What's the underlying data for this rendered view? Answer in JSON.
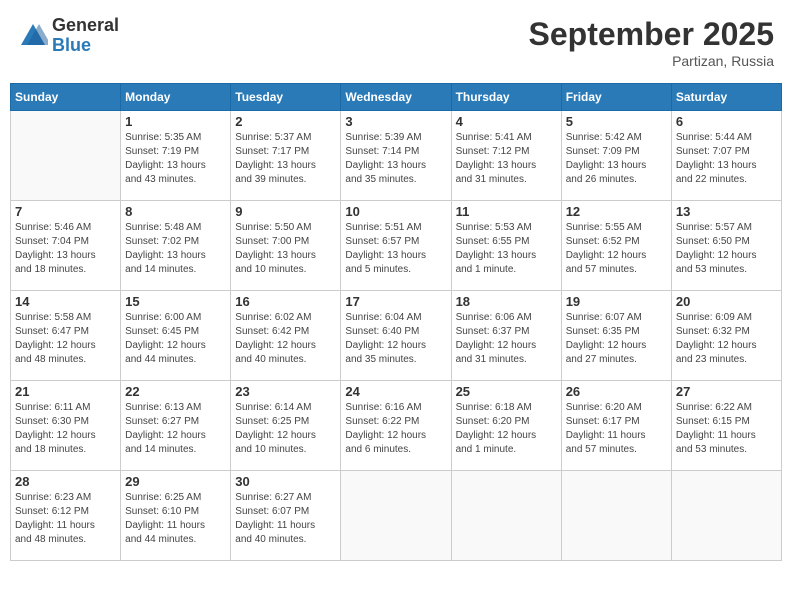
{
  "header": {
    "logo_general": "General",
    "logo_blue": "Blue",
    "month_title": "September 2025",
    "subtitle": "Partizan, Russia"
  },
  "days_of_week": [
    "Sunday",
    "Monday",
    "Tuesday",
    "Wednesday",
    "Thursday",
    "Friday",
    "Saturday"
  ],
  "weeks": [
    [
      {
        "day": "",
        "info": ""
      },
      {
        "day": "1",
        "info": "Sunrise: 5:35 AM\nSunset: 7:19 PM\nDaylight: 13 hours\nand 43 minutes."
      },
      {
        "day": "2",
        "info": "Sunrise: 5:37 AM\nSunset: 7:17 PM\nDaylight: 13 hours\nand 39 minutes."
      },
      {
        "day": "3",
        "info": "Sunrise: 5:39 AM\nSunset: 7:14 PM\nDaylight: 13 hours\nand 35 minutes."
      },
      {
        "day": "4",
        "info": "Sunrise: 5:41 AM\nSunset: 7:12 PM\nDaylight: 13 hours\nand 31 minutes."
      },
      {
        "day": "5",
        "info": "Sunrise: 5:42 AM\nSunset: 7:09 PM\nDaylight: 13 hours\nand 26 minutes."
      },
      {
        "day": "6",
        "info": "Sunrise: 5:44 AM\nSunset: 7:07 PM\nDaylight: 13 hours\nand 22 minutes."
      }
    ],
    [
      {
        "day": "7",
        "info": "Sunrise: 5:46 AM\nSunset: 7:04 PM\nDaylight: 13 hours\nand 18 minutes."
      },
      {
        "day": "8",
        "info": "Sunrise: 5:48 AM\nSunset: 7:02 PM\nDaylight: 13 hours\nand 14 minutes."
      },
      {
        "day": "9",
        "info": "Sunrise: 5:50 AM\nSunset: 7:00 PM\nDaylight: 13 hours\nand 10 minutes."
      },
      {
        "day": "10",
        "info": "Sunrise: 5:51 AM\nSunset: 6:57 PM\nDaylight: 13 hours\nand 5 minutes."
      },
      {
        "day": "11",
        "info": "Sunrise: 5:53 AM\nSunset: 6:55 PM\nDaylight: 13 hours\nand 1 minute."
      },
      {
        "day": "12",
        "info": "Sunrise: 5:55 AM\nSunset: 6:52 PM\nDaylight: 12 hours\nand 57 minutes."
      },
      {
        "day": "13",
        "info": "Sunrise: 5:57 AM\nSunset: 6:50 PM\nDaylight: 12 hours\nand 53 minutes."
      }
    ],
    [
      {
        "day": "14",
        "info": "Sunrise: 5:58 AM\nSunset: 6:47 PM\nDaylight: 12 hours\nand 48 minutes."
      },
      {
        "day": "15",
        "info": "Sunrise: 6:00 AM\nSunset: 6:45 PM\nDaylight: 12 hours\nand 44 minutes."
      },
      {
        "day": "16",
        "info": "Sunrise: 6:02 AM\nSunset: 6:42 PM\nDaylight: 12 hours\nand 40 minutes."
      },
      {
        "day": "17",
        "info": "Sunrise: 6:04 AM\nSunset: 6:40 PM\nDaylight: 12 hours\nand 35 minutes."
      },
      {
        "day": "18",
        "info": "Sunrise: 6:06 AM\nSunset: 6:37 PM\nDaylight: 12 hours\nand 31 minutes."
      },
      {
        "day": "19",
        "info": "Sunrise: 6:07 AM\nSunset: 6:35 PM\nDaylight: 12 hours\nand 27 minutes."
      },
      {
        "day": "20",
        "info": "Sunrise: 6:09 AM\nSunset: 6:32 PM\nDaylight: 12 hours\nand 23 minutes."
      }
    ],
    [
      {
        "day": "21",
        "info": "Sunrise: 6:11 AM\nSunset: 6:30 PM\nDaylight: 12 hours\nand 18 minutes."
      },
      {
        "day": "22",
        "info": "Sunrise: 6:13 AM\nSunset: 6:27 PM\nDaylight: 12 hours\nand 14 minutes."
      },
      {
        "day": "23",
        "info": "Sunrise: 6:14 AM\nSunset: 6:25 PM\nDaylight: 12 hours\nand 10 minutes."
      },
      {
        "day": "24",
        "info": "Sunrise: 6:16 AM\nSunset: 6:22 PM\nDaylight: 12 hours\nand 6 minutes."
      },
      {
        "day": "25",
        "info": "Sunrise: 6:18 AM\nSunset: 6:20 PM\nDaylight: 12 hours\nand 1 minute."
      },
      {
        "day": "26",
        "info": "Sunrise: 6:20 AM\nSunset: 6:17 PM\nDaylight: 11 hours\nand 57 minutes."
      },
      {
        "day": "27",
        "info": "Sunrise: 6:22 AM\nSunset: 6:15 PM\nDaylight: 11 hours\nand 53 minutes."
      }
    ],
    [
      {
        "day": "28",
        "info": "Sunrise: 6:23 AM\nSunset: 6:12 PM\nDaylight: 11 hours\nand 48 minutes."
      },
      {
        "day": "29",
        "info": "Sunrise: 6:25 AM\nSunset: 6:10 PM\nDaylight: 11 hours\nand 44 minutes."
      },
      {
        "day": "30",
        "info": "Sunrise: 6:27 AM\nSunset: 6:07 PM\nDaylight: 11 hours\nand 40 minutes."
      },
      {
        "day": "",
        "info": ""
      },
      {
        "day": "",
        "info": ""
      },
      {
        "day": "",
        "info": ""
      },
      {
        "day": "",
        "info": ""
      }
    ]
  ]
}
